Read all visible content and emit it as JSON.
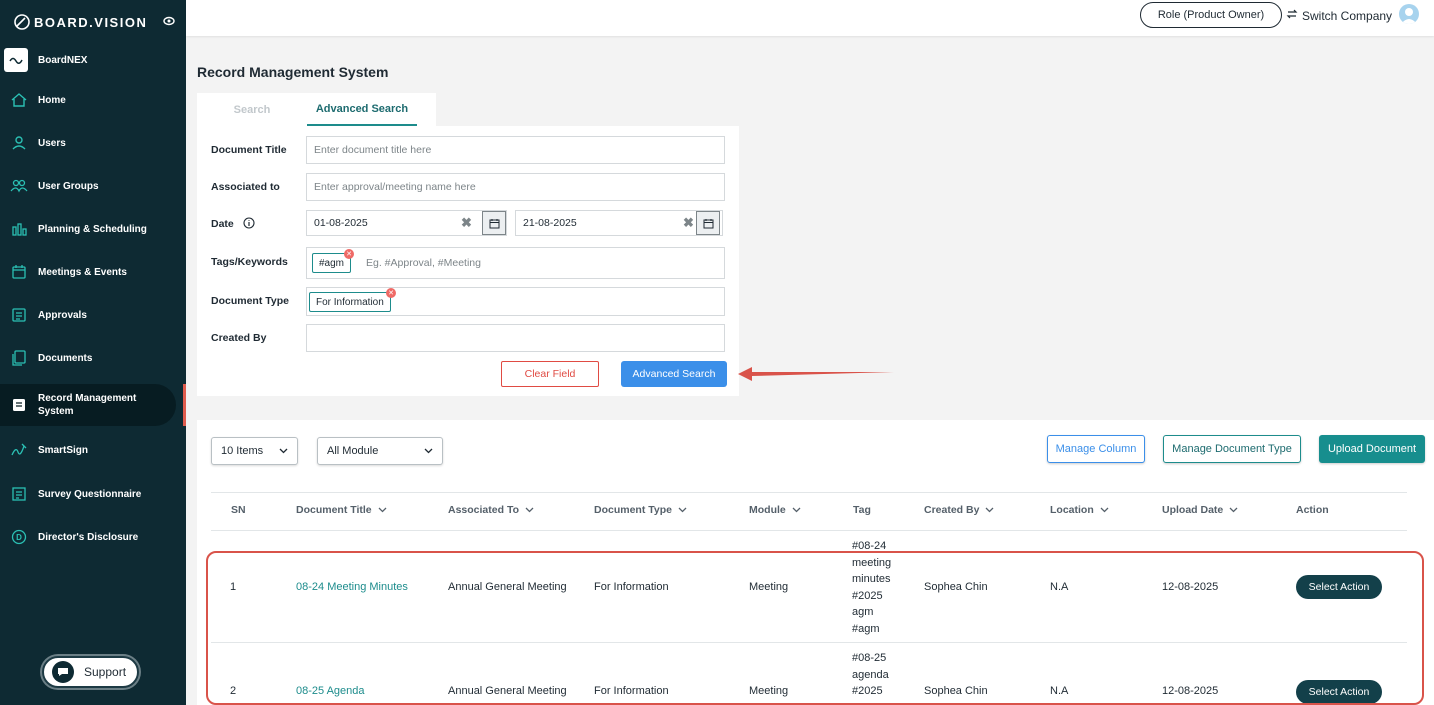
{
  "app": {
    "brand": "BOARD.VISION",
    "org_name": "BoardNEX"
  },
  "sidebar": {
    "items": [
      {
        "label": "Home",
        "icon": "home-icon"
      },
      {
        "label": "Users",
        "icon": "user-icon"
      },
      {
        "label": "User Groups",
        "icon": "user-groups-icon"
      },
      {
        "label": "Planning & Scheduling",
        "icon": "bar-chart-icon"
      },
      {
        "label": "Meetings & Events",
        "icon": "calendar-icon"
      },
      {
        "label": "Approvals",
        "icon": "approvals-icon"
      },
      {
        "label": "Documents",
        "icon": "documents-icon"
      },
      {
        "label": "Record Management System",
        "icon": "records-icon",
        "active": true
      },
      {
        "label": "SmartSign",
        "icon": "signature-icon"
      },
      {
        "label": "Survey Questionnaire",
        "icon": "survey-icon"
      },
      {
        "label": "Director's Disclosure",
        "icon": "disclosure-icon"
      }
    ],
    "support_label": "Support"
  },
  "topbar": {
    "role_label": "Role (Product Owner)",
    "switch_label": "Switch Company"
  },
  "page": {
    "title": "Record Management System"
  },
  "tabs": [
    {
      "label": "Search"
    },
    {
      "label": "Advanced Search",
      "active": true
    }
  ],
  "form": {
    "document_title": {
      "label": "Document Title",
      "placeholder": "Enter document title here"
    },
    "associated_to": {
      "label": "Associated to",
      "placeholder": "Enter approval/meeting name here"
    },
    "date": {
      "label": "Date",
      "from": "01-08-2025",
      "to": "21-08-2025"
    },
    "tags": {
      "label": "Tags/Keywords",
      "chips": [
        "#agm"
      ],
      "placeholder": "Eg. #Approval, #Meeting"
    },
    "document_type": {
      "label": "Document Type",
      "chips": [
        "For Information"
      ]
    },
    "created_by": {
      "label": "Created By",
      "value": ""
    },
    "clear_label": "Clear Field",
    "search_label": "Advanced Search"
  },
  "toolbar": {
    "items_per_page": "10 Items",
    "module_filter": "All Module",
    "manage_column": "Manage Column",
    "manage_document_type": "Manage Document Type",
    "upload_document": "Upload Document"
  },
  "table": {
    "columns": [
      "SN",
      "Document Title",
      "Associated To",
      "Document Type",
      "Module",
      "Tag",
      "Created By",
      "Location",
      "Upload Date",
      "Action"
    ],
    "rows": [
      {
        "sn": "1",
        "title": "08-24 Meeting Minutes",
        "associated_to": "Annual General Meeting",
        "document_type": "For Information",
        "module": "Meeting",
        "tags": [
          "#08-24",
          "meeting",
          "minutes",
          "#2025",
          "agm",
          "#agm"
        ],
        "created_by": "Sophea Chin",
        "location": "N.A",
        "upload_date": "12-08-2025",
        "action": "Select Action"
      },
      {
        "sn": "2",
        "title": "08-25 Agenda",
        "associated_to": "Annual General Meeting",
        "document_type": "For Information",
        "module": "Meeting",
        "tags": [
          "#08-25",
          "agenda",
          "#2025"
        ],
        "created_by": "Sophea Chin",
        "location": "N.A",
        "upload_date": "12-08-2025",
        "action": "Select Action"
      }
    ]
  },
  "colors": {
    "sidebar": "#0e2a33",
    "accent": "#1d8c8c",
    "primary": "#3b8fe9",
    "danger": "#e04b43",
    "action": "#13404a"
  }
}
